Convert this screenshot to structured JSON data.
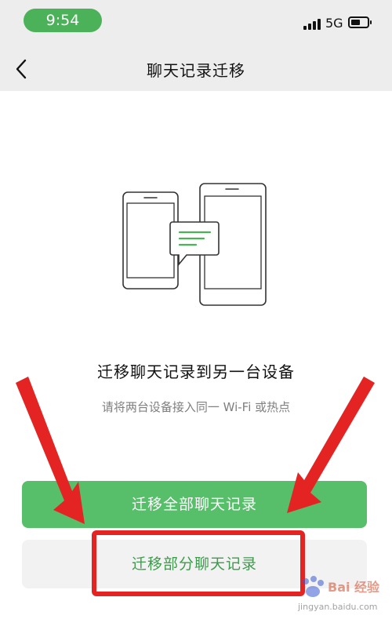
{
  "status_bar": {
    "time": "9:54",
    "network": "5G",
    "accent": "#4cb25a"
  },
  "nav": {
    "back_icon": "chevron-left-icon",
    "title": "聊天记录迁移"
  },
  "main": {
    "illustration_icon": "phone-transfer-icon",
    "headline": "迁移聊天记录到另一台设备",
    "subtext": "请将两台设备接入同一 Wi-Fi 或热点",
    "primary_button": "迁移全部聊天记录",
    "secondary_button": "迁移部分聊天记录"
  },
  "colors": {
    "primary_green": "#57be6a",
    "secondary_text_green": "#3d9b4c",
    "annotation_red": "#e32422"
  },
  "annotations": {
    "arrow_icon": "red-arrow-icon",
    "highlight": "red-highlight-box"
  },
  "watermark": {
    "logo_text": "Bai 经验",
    "url": "jingyan.baidu.com"
  }
}
